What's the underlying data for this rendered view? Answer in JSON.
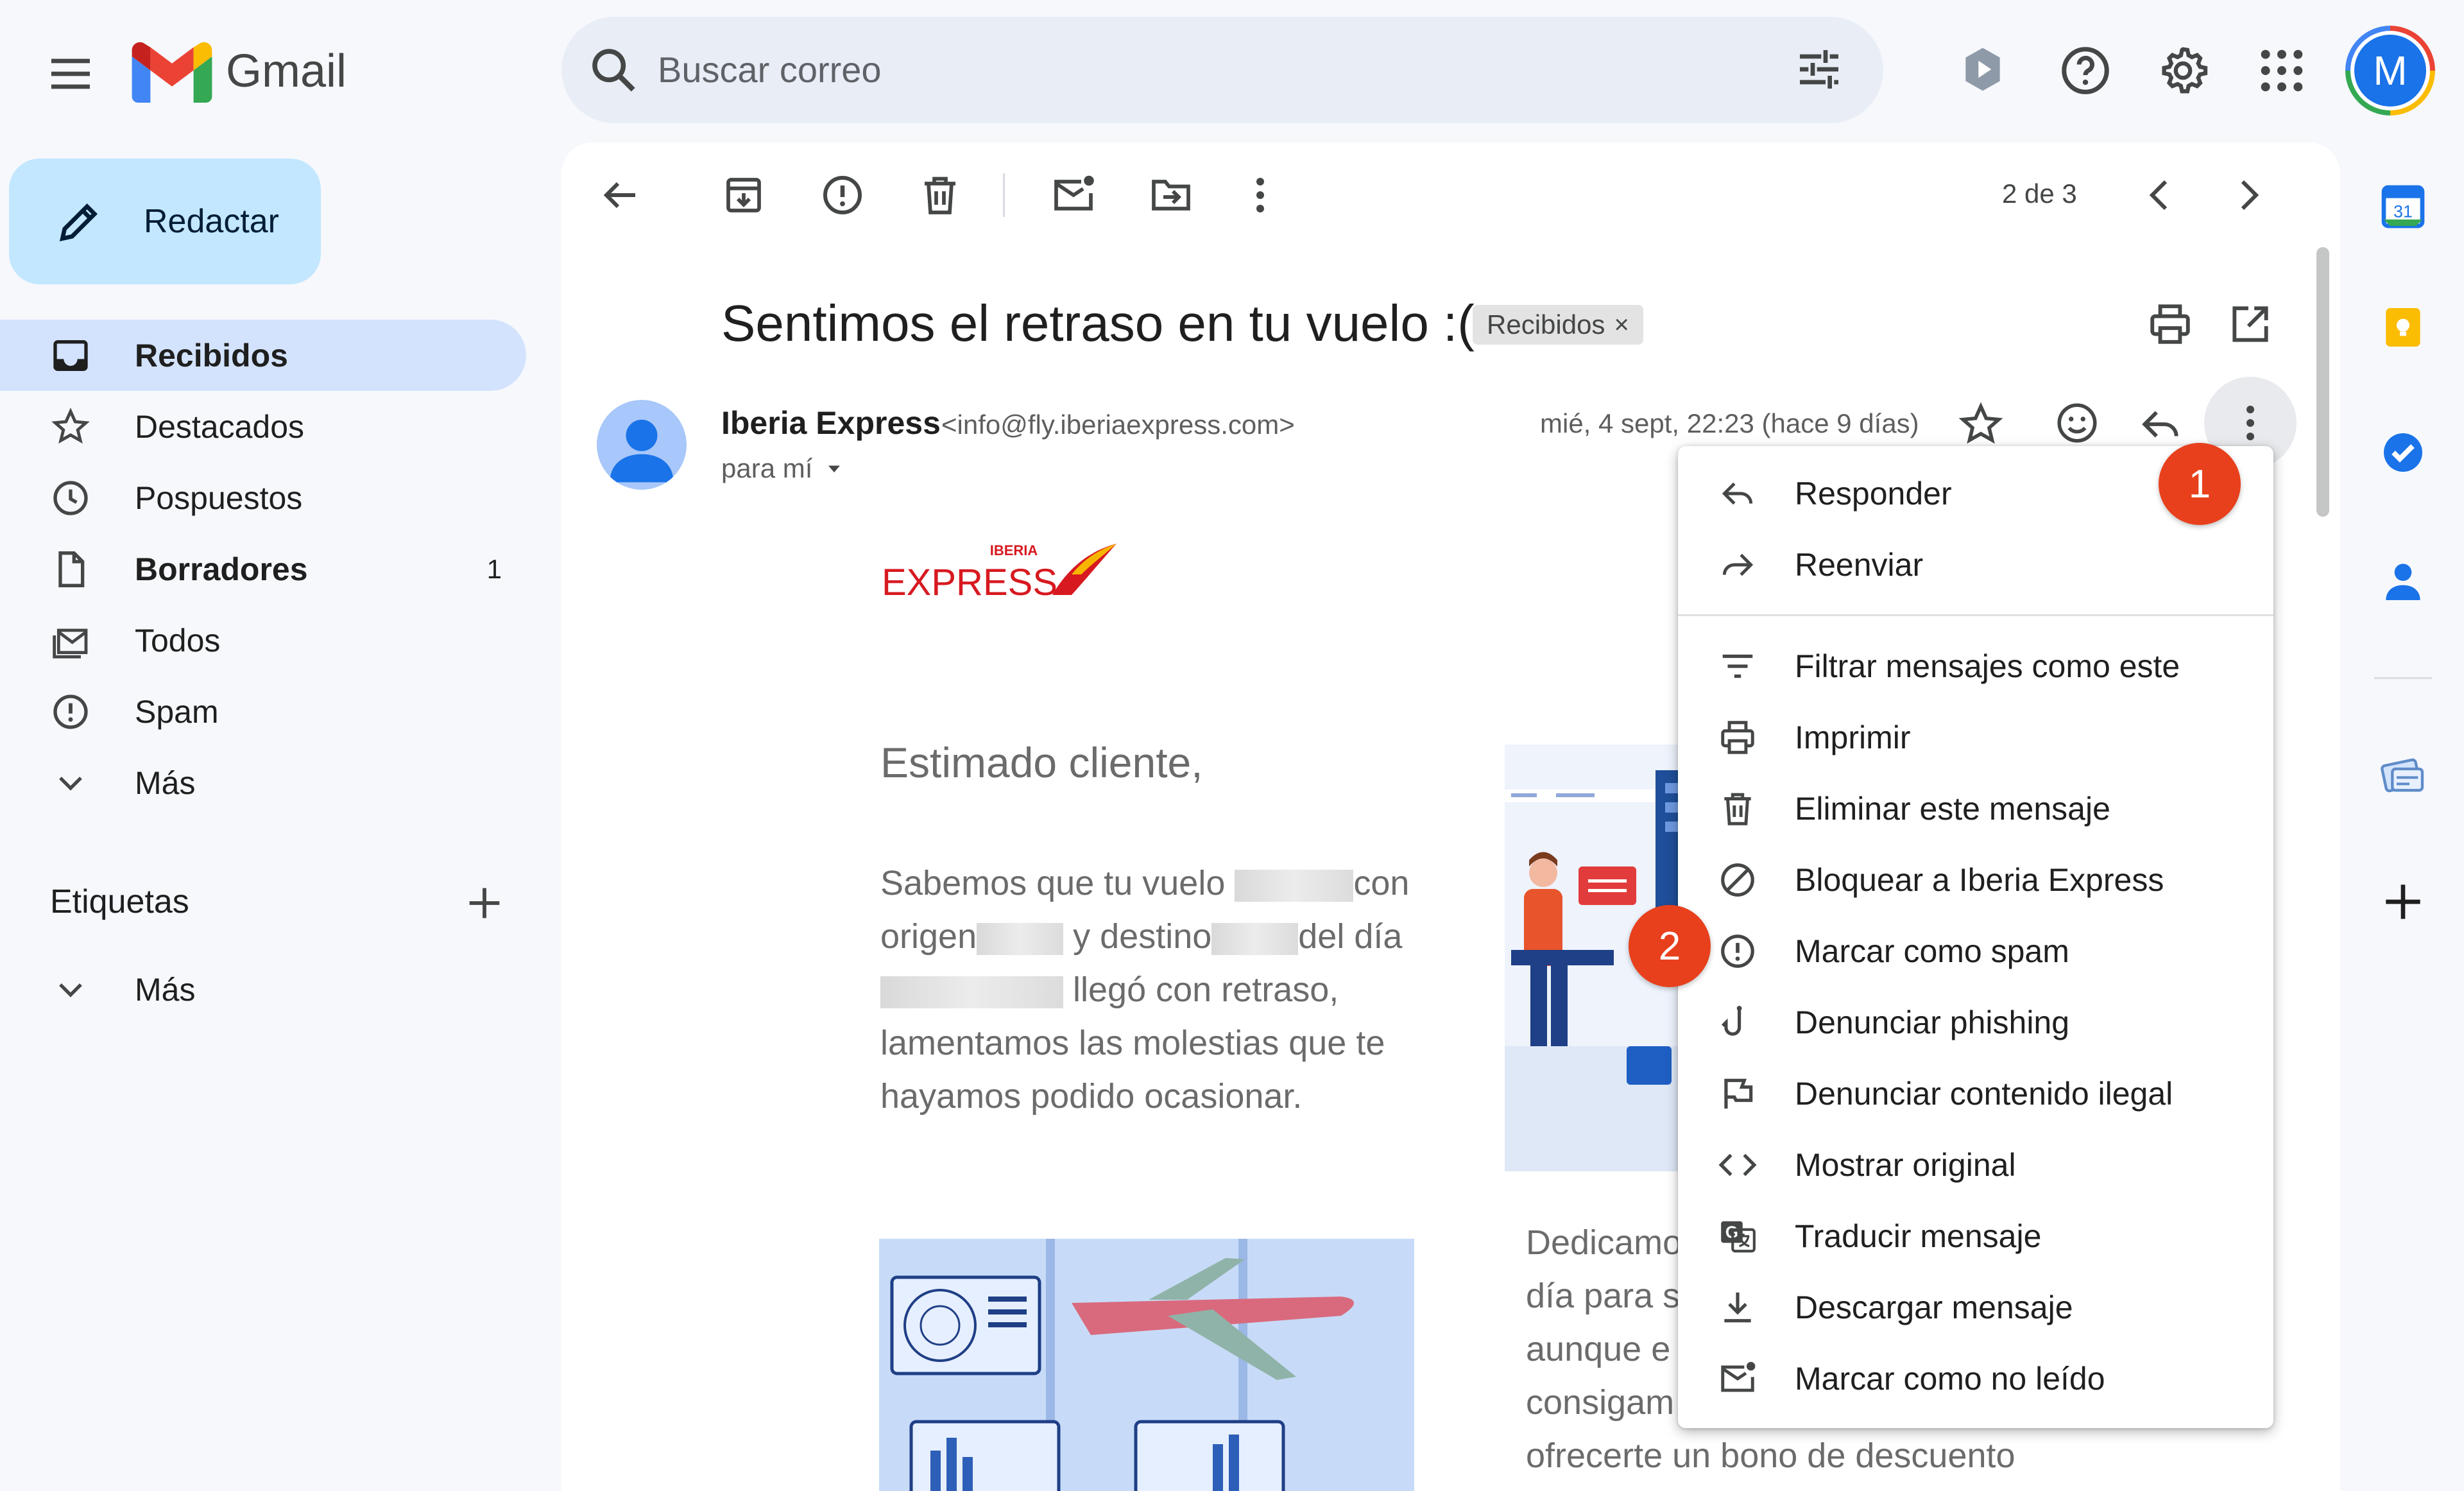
{
  "app": {
    "name": "Gmail"
  },
  "search": {
    "placeholder": "Buscar correo"
  },
  "user": {
    "avatar_letter": "M"
  },
  "compose": {
    "label": "Redactar"
  },
  "sidebar": {
    "items": [
      {
        "label": "Recibidos",
        "icon": "inbox-icon",
        "active": true
      },
      {
        "label": "Destacados",
        "icon": "star-icon"
      },
      {
        "label": "Pospuestos",
        "icon": "clock-icon"
      },
      {
        "label": "Borradores",
        "icon": "draft-icon",
        "count": "1"
      },
      {
        "label": "Todos",
        "icon": "all-mail-icon"
      },
      {
        "label": "Spam",
        "icon": "spam-icon"
      },
      {
        "label": "Más",
        "icon": "chevron-down-icon"
      }
    ],
    "labels_title": "Etiquetas",
    "labels_more": "Más"
  },
  "toolbar": {
    "pager": "2 de 3"
  },
  "message": {
    "subject": "Sentimos el retraso en tu vuelo :(",
    "label_chip": "Recibidos",
    "label_chip_close": "×",
    "sender_name": "Iberia Express",
    "sender_email": "<info@fly.iberiaexpress.com>",
    "to": "para mí",
    "date": "mié, 4 sept, 22:23 (hace 9 días)",
    "logo_small": "IBERIA",
    "logo_big": "EXPRESS",
    "greeting": "Estimado cliente,",
    "body_1": "Sabemos que tu vuelo",
    "body_2": "con",
    "body_3": "origen",
    "body_4": "y destino",
    "body_5": "del día",
    "body_6": "llegó con retraso,",
    "body_7": "lamentamos las molestias que te",
    "body_8": "hayamos podido ocasionar.",
    "body2_lines": [
      "Dedicamo",
      "día para s",
      "aunque e",
      "consigam",
      "ofrecerte un bono de descuento"
    ]
  },
  "menu": {
    "items": [
      {
        "label": "Responder",
        "icon": "reply-icon"
      },
      {
        "label": "Reenviar",
        "icon": "forward-icon"
      },
      {
        "label": "Filtrar mensajes como este",
        "icon": "filter-icon"
      },
      {
        "label": "Imprimir",
        "icon": "print-icon"
      },
      {
        "label": "Eliminar este mensaje",
        "icon": "trash-icon"
      },
      {
        "label": "Bloquear a Iberia Express",
        "icon": "block-icon"
      },
      {
        "label": "Marcar como spam",
        "icon": "spam-icon"
      },
      {
        "label": "Denunciar phishing",
        "icon": "phishing-hook-icon"
      },
      {
        "label": "Denunciar contenido ilegal",
        "icon": "flag-icon"
      },
      {
        "label": "Mostrar original",
        "icon": "code-icon"
      },
      {
        "label": "Traducir mensaje",
        "icon": "translate-icon"
      },
      {
        "label": "Descargar mensaje",
        "icon": "download-icon"
      },
      {
        "label": "Marcar como no leído",
        "icon": "mark-unread-icon"
      }
    ]
  },
  "annotations": {
    "step_1": "1",
    "step_2": "2"
  },
  "side_panel": {
    "calendar_day": "31"
  },
  "colors": {
    "accent": "#0b57d0",
    "compose_bg": "#c2e7ff",
    "active_nav": "#d3e3fd",
    "badge": "#e8401c",
    "iberia_red": "#d71920"
  }
}
